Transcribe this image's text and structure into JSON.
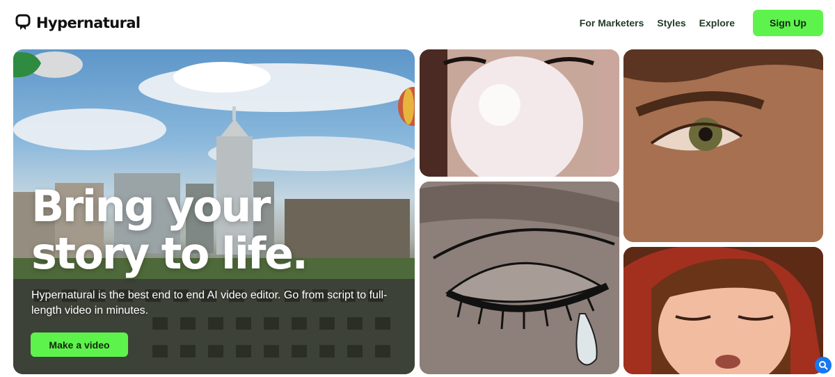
{
  "brand": {
    "name": "Hypernatural",
    "logo_icon": "chat-bubble-icon"
  },
  "nav": {
    "links": [
      "For Marketers",
      "Styles",
      "Explore"
    ],
    "signup_label": "Sign Up"
  },
  "hero": {
    "title_line1": "Bring your",
    "title_line2": "story to life.",
    "description": "Hypernatural is the best end to end AI video editor. Go from script to full-length video in minutes.",
    "cta_label": "Make a video"
  },
  "gallery": {
    "items": [
      {
        "name": "bubble-gum-portrait"
      },
      {
        "name": "animated-tear-eye"
      },
      {
        "name": "closeup-eye"
      },
      {
        "name": "animated-girl-red-hood"
      }
    ]
  },
  "colors": {
    "accent": "#5ef34c",
    "nav_text": "#1e3a26",
    "fab": "#1877f2"
  },
  "fab": {
    "icon": "search-icon"
  }
}
